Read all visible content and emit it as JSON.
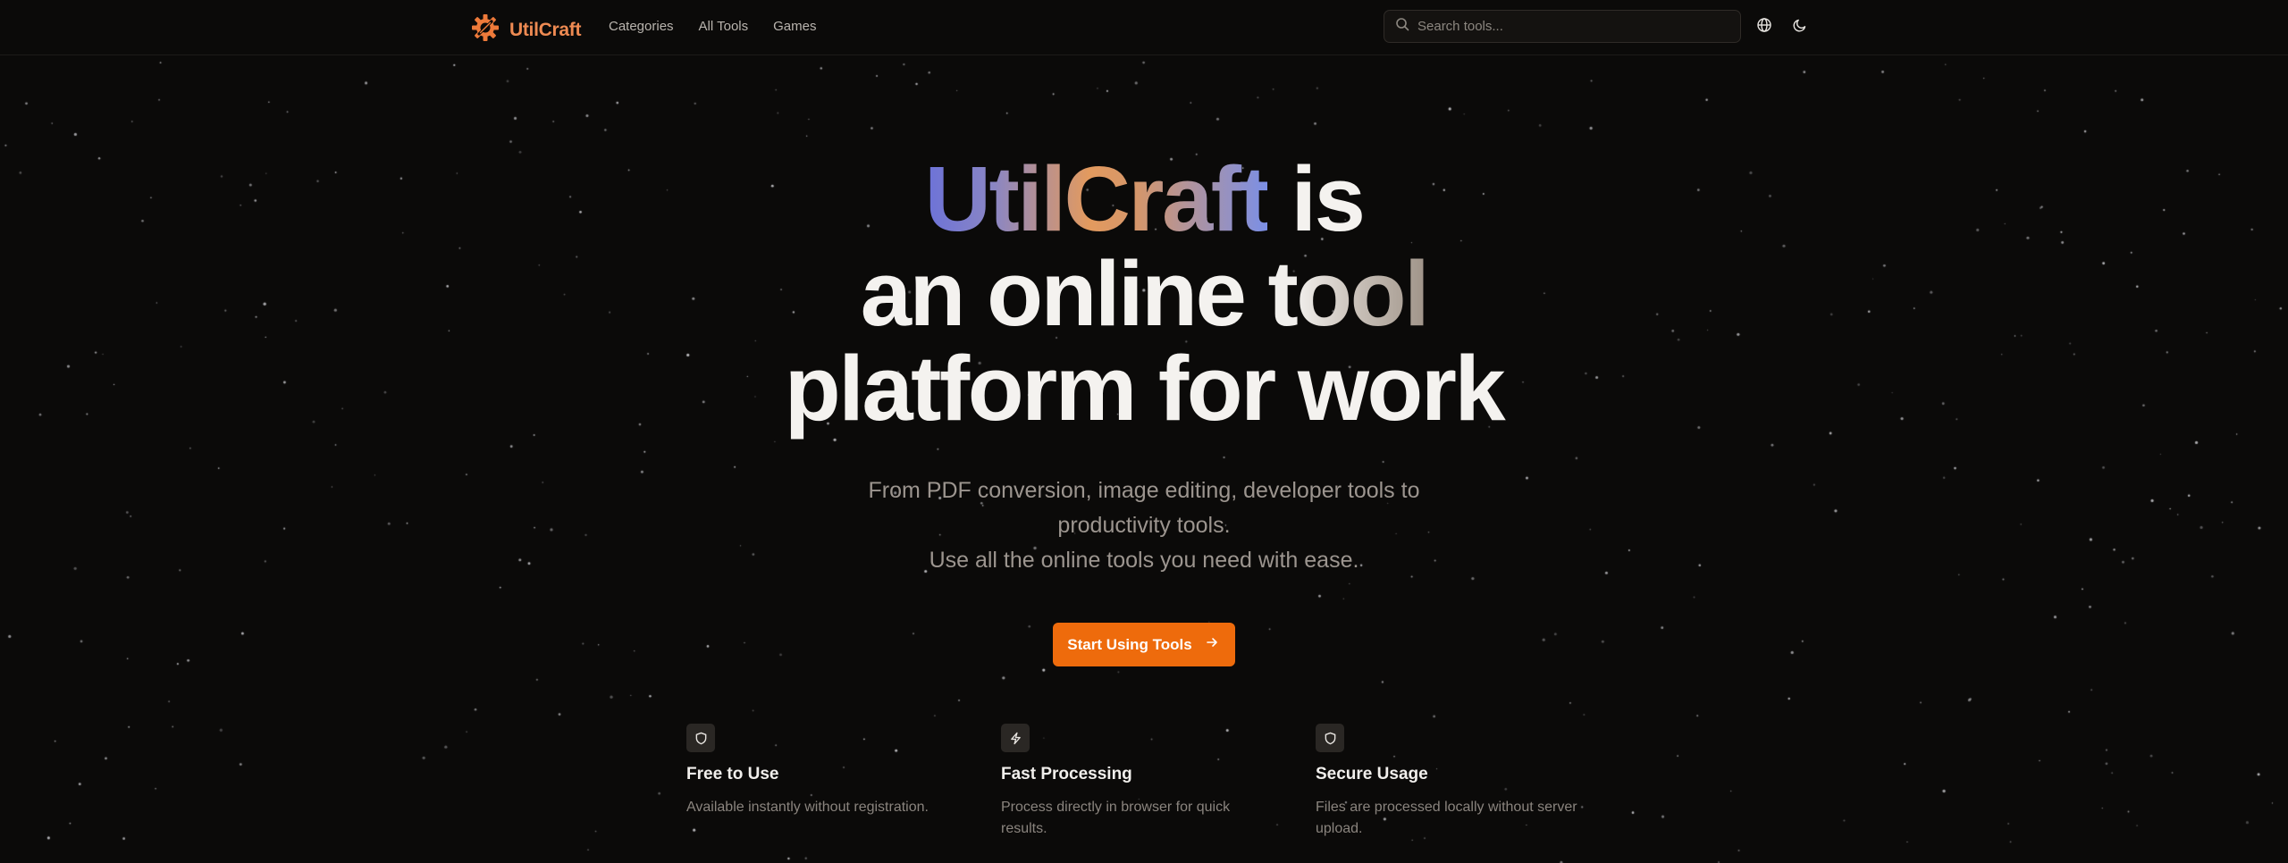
{
  "header": {
    "brand": "UtilCraft",
    "nav": [
      "Categories",
      "All Tools",
      "Games"
    ],
    "search_placeholder": "Search tools...",
    "icons": {
      "logo": "gear-logo-icon",
      "search": "search-icon",
      "language": "globe-icon",
      "theme": "moon-icon"
    }
  },
  "hero": {
    "title_brand": "UtilCraft",
    "title_is": " is",
    "title_line2_plain": "an online ",
    "title_line2_grad": "tool",
    "title_line3": "platform for work",
    "subtitle_line1": "From PDF conversion, image editing, developer tools to",
    "subtitle_line2": "productivity tools.",
    "subtitle_line3": "Use all the online tools you need with ease.",
    "cta_label": "Start Using Tools"
  },
  "features": [
    {
      "icon": "shield-icon",
      "title": "Free to Use",
      "desc": "Available instantly without registration."
    },
    {
      "icon": "lightning-icon",
      "title": "Fast Processing",
      "desc": "Process directly in browser for quick results."
    },
    {
      "icon": "shield-icon",
      "title": "Secure Usage",
      "desc": "Files are processed locally without server upload."
    }
  ],
  "colors": {
    "accent": "#ee6b0c",
    "brand": "#ee8a52",
    "background": "#0b0a09"
  }
}
